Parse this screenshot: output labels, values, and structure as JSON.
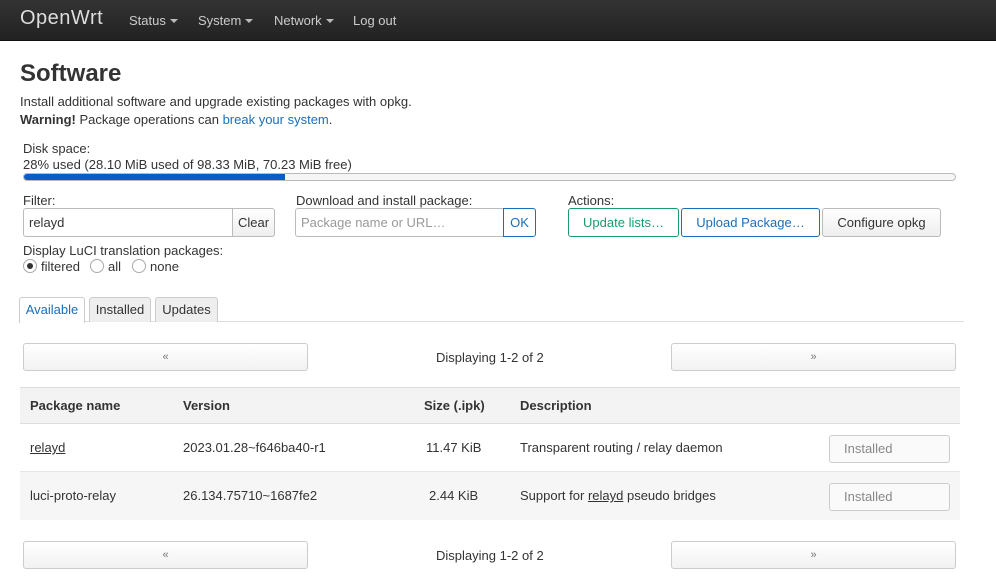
{
  "nav": {
    "brand": "OpenWrt",
    "items": [
      "Status",
      "System",
      "Network"
    ],
    "logout": "Log out"
  },
  "page": {
    "title": "Software",
    "intro": "Install additional software and upgrade existing packages with opkg.",
    "warning_bold": "Warning!",
    "warning_text": " Package operations can ",
    "warning_link": "break your system",
    "warning_end": "."
  },
  "disk": {
    "label": "Disk space:",
    "text": "28% used (28.10 MiB used of 98.33 MiB, 70.23 MiB free)",
    "percent": 28
  },
  "filter": {
    "label": "Filter:",
    "value": "relayd",
    "clear": "Clear"
  },
  "download": {
    "label": "Download and install package:",
    "placeholder": "Package name or URL…",
    "ok": "OK"
  },
  "actions": {
    "label": "Actions:",
    "update": "Update lists…",
    "upload": "Upload Package…",
    "configure": "Configure opkg"
  },
  "translation": {
    "label": "Display LuCI translation packages:",
    "options": [
      "filtered",
      "all",
      "none"
    ],
    "selected": "filtered"
  },
  "tabs": [
    "Available",
    "Installed",
    "Updates"
  ],
  "pager": {
    "prev": "«",
    "next": "»",
    "status": "Displaying 1-2 of 2"
  },
  "table": {
    "headers": [
      "Package name",
      "Version",
      "Size (.ipk)",
      "Description"
    ],
    "rows": [
      {
        "name": "relayd",
        "version": "2023.01.28~f646ba40-r1",
        "size": "11.47 KiB",
        "description": "Transparent routing / relay daemon",
        "action": "Installed"
      },
      {
        "name": "luci-proto-relay",
        "version": "26.134.75710~1687fe2",
        "size": "2.44 KiB",
        "desc_before": "Support for ",
        "desc_link": "relayd",
        "desc_after": " pseudo bridges",
        "action": "Installed"
      }
    ]
  }
}
